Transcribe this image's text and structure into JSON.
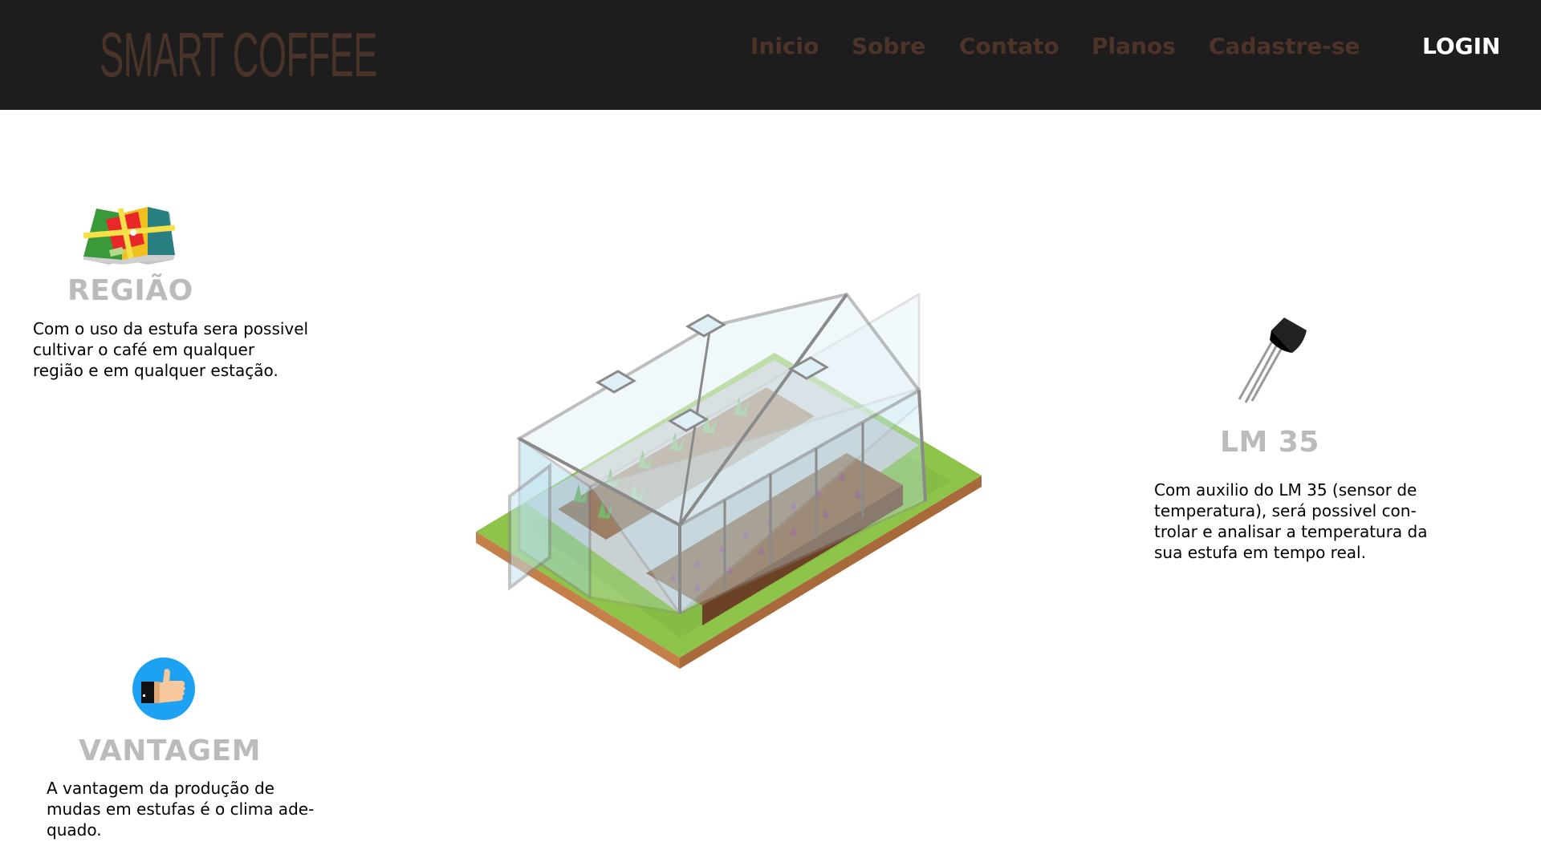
{
  "header": {
    "logo": "SMART COFFEE",
    "nav": [
      "Inicio",
      "Sobre",
      "Contato",
      "Planos",
      "Cadastre-se"
    ],
    "login": "LOGIN"
  },
  "features": {
    "regiao": {
      "icon": "map-icon",
      "title": "REGIÃO",
      "lines": [
        "Com o uso da estufa sera possivel",
        "cultivar o café em qualquer",
        "região e em qualquer estação."
      ]
    },
    "vantagem": {
      "icon": "thumbs-up-icon",
      "title": "VANTAGEM",
      "lines": [
        "A vantagem da produção de",
        "mudas em estufas é o clima ade-",
        "quado."
      ]
    },
    "lm35": {
      "icon": "temperature-sensor-icon",
      "title": "LM 35",
      "lines": [
        "Com auxilio do LM 35 (sensor de",
        "temperatura), será possivel con-",
        "trolar e analisar a temperatura da",
        "sua estufa em tempo real."
      ]
    }
  },
  "illustration": {
    "icon": "greenhouse-illustration"
  },
  "colors": {
    "header_bg": "#1d1d1d",
    "brand_brown": "#4e3428",
    "title_gray": "#bbbbbb",
    "login": "#ffffff"
  }
}
